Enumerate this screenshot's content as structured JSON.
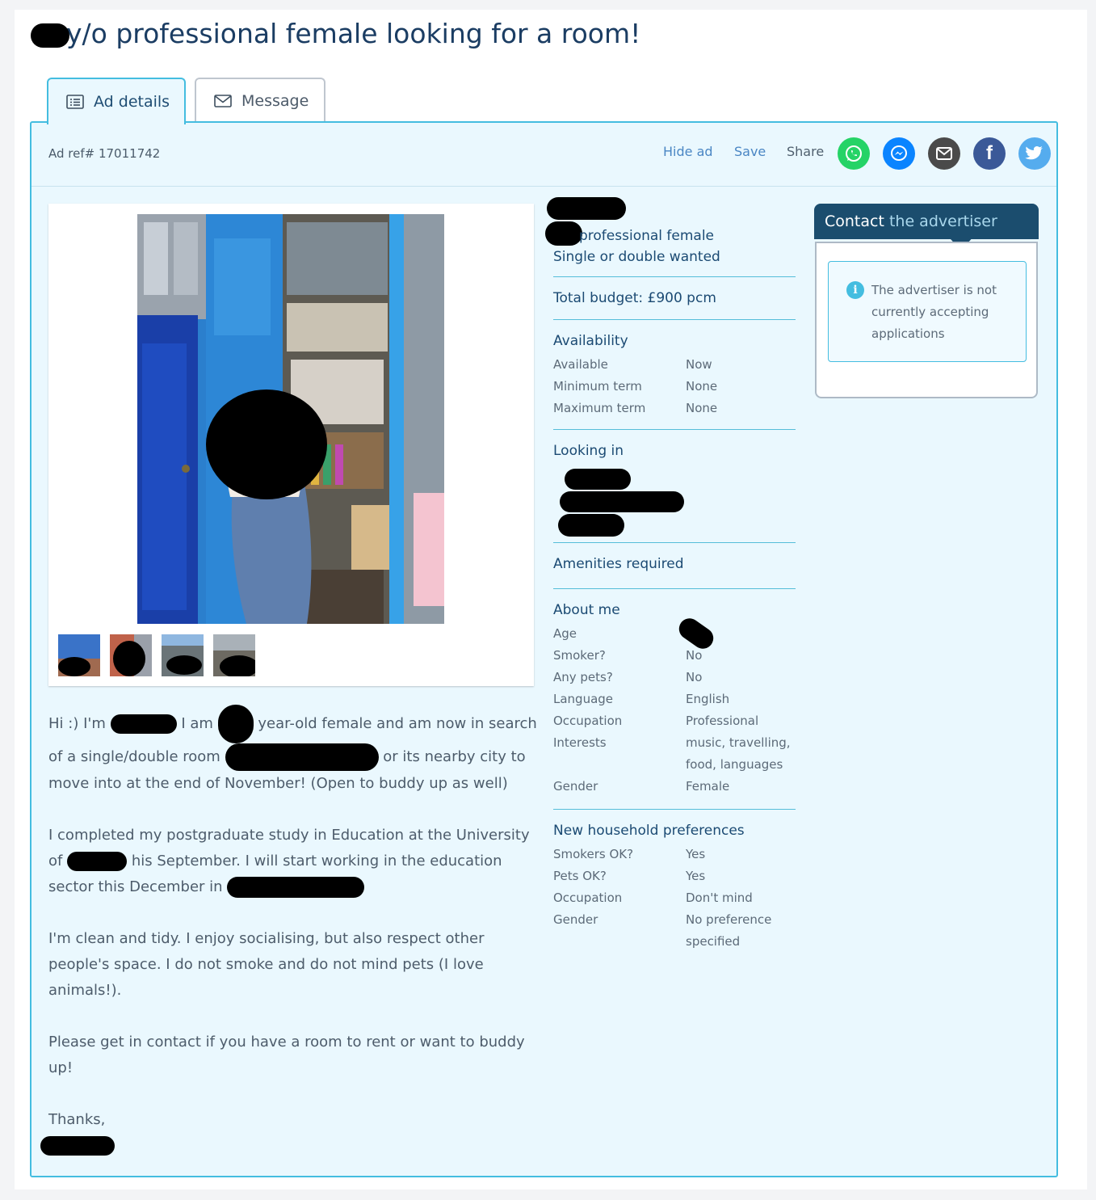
{
  "page": {
    "title": "y/o professional female looking for a room!"
  },
  "tabs": [
    {
      "label": "Ad details",
      "icon": "list-icon",
      "active": true
    },
    {
      "label": "Message",
      "icon": "envelope-icon",
      "active": false
    }
  ],
  "toolbar": {
    "ad_ref": "Ad ref# 17011742",
    "hide_label": "Hide ad",
    "save_label": "Save",
    "share_label": "Share",
    "share_icons": [
      {
        "name": "whatsapp-icon",
        "color": "#25d366"
      },
      {
        "name": "messenger-icon",
        "color": "#0a84ff"
      },
      {
        "name": "email-icon",
        "color": "#4a4a4a"
      },
      {
        "name": "facebook-icon",
        "color": "#3b5998"
      },
      {
        "name": "twitter-icon",
        "color": "#55acee"
      }
    ]
  },
  "summary": {
    "line1": "professional female",
    "line2": "Single or double wanted",
    "budget": "Total budget: £900 pcm"
  },
  "availability": {
    "heading": "Availability",
    "rows": [
      {
        "k": "Available",
        "v": "Now"
      },
      {
        "k": "Minimum term",
        "v": "None"
      },
      {
        "k": "Maximum term",
        "v": "None"
      }
    ]
  },
  "looking_in": {
    "heading": "Looking in"
  },
  "amenities": {
    "heading": "Amenities required"
  },
  "about_me": {
    "heading": "About me",
    "rows": [
      {
        "k": "Age",
        "v": ""
      },
      {
        "k": "Smoker?",
        "v": "No"
      },
      {
        "k": "Any pets?",
        "v": "No"
      },
      {
        "k": "Language",
        "v": "English"
      },
      {
        "k": "Occupation",
        "v": "Professional"
      },
      {
        "k": "Interests",
        "v": "music, travelling, food, languages"
      },
      {
        "k": "Gender",
        "v": "Female"
      }
    ]
  },
  "household": {
    "heading": "New household preferences",
    "rows": [
      {
        "k": "Smokers OK?",
        "v": "Yes"
      },
      {
        "k": "Pets OK?",
        "v": "Yes"
      },
      {
        "k": "Occupation",
        "v": "Don't mind"
      },
      {
        "k": "Gender",
        "v": "No preference specified"
      }
    ]
  },
  "contact": {
    "title_strong": "Contact",
    "title_light": " the advertiser",
    "notice": "The advertiser is not currently accepting applications"
  },
  "description": {
    "p1_a": "Hi :) I'm",
    "p1_b": "I am",
    "p1_c": "year-old female and am now in search of a single/double room",
    "p1_d": "or its nearby city to move into at the end of November! (Open to buddy up as well)",
    "p2_a": "I completed my postgraduate study in Education at the University of",
    "p2_b": "his September. I will start working in the education sector this December in",
    "p3": "I'm clean and tidy. I enjoy socialising, but also respect other people's space. I do not smoke and do not mind pets (I love animals!).",
    "p4": "Please get in contact if you have a room to rent or want to buddy up!",
    "p5": "Thanks,"
  }
}
